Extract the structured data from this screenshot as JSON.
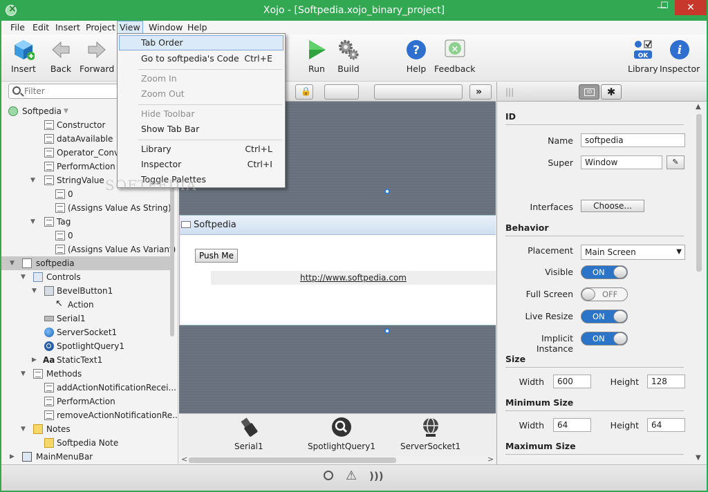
{
  "window": {
    "title": "Xojo - [Softpedia.xojo_binary_project]",
    "minimize_glyph": "—",
    "maximize_glyph": "☐",
    "close_glyph": "✕",
    "accent_color": "#33a853"
  },
  "menubar": [
    "File",
    "Edit",
    "Insert",
    "Project",
    "View",
    "Window",
    "Help"
  ],
  "toolbar": {
    "insert": "Insert",
    "back": "Back",
    "forward": "Forward",
    "run": "Run",
    "build": "Build",
    "help": "Help",
    "feedback": "Feedback",
    "library": "Library",
    "library_ok": "OK",
    "inspector": "Inspector"
  },
  "view_menu": {
    "tab_order": "Tab Order",
    "goto_code": "Go to softpedia's Code",
    "goto_code_shortcut": "Ctrl+E",
    "zoom_in": "Zoom In",
    "zoom_out": "Zoom Out",
    "hide_toolbar": "Hide Toolbar",
    "show_tab_bar": "Show Tab Bar",
    "library": "Library",
    "library_shortcut": "Ctrl+L",
    "inspector": "Inspector",
    "inspector_shortcut": "Ctrl+I",
    "toggle_palettes": "Toggle Palettes"
  },
  "navigator": {
    "filter_placeholder": "Filter",
    "project": "Softpedia",
    "items": [
      "Constructor",
      "dataAvailable",
      "Operator_Conver",
      "PerformAction",
      "StringValue",
      "0",
      "(Assigns Value As String)",
      "Tag",
      "0",
      "(Assigns Value As Variant)",
      "softpedia",
      "Controls",
      "BevelButton1",
      "Action",
      "Serial1",
      "ServerSocket1",
      "SpotlightQuery1",
      "StaticText1",
      "Methods",
      "addActionNotificationRecei...",
      "PerformAction",
      "removeActionNotificationRe...",
      "Notes",
      "Softpedia Note",
      "MainMenuBar"
    ]
  },
  "designer": {
    "window_title": "Softpedia",
    "push_button": "Push Me",
    "url_text": "http://www.softpedia.com",
    "tray": [
      "Serial1",
      "SpotlightQuery1",
      "ServerSocket1"
    ]
  },
  "inspector": {
    "sections": {
      "id": "ID",
      "behavior": "Behavior",
      "size": "Size",
      "min_size": "Minimum Size",
      "max_size": "Maximum Size"
    },
    "name_label": "Name",
    "name_value": "softpedia",
    "super_label": "Super",
    "super_value": "Window",
    "interfaces_label": "Interfaces",
    "choose_button": "Choose...",
    "placement_label": "Placement",
    "placement_value": "Main Screen",
    "visible_label": "Visible",
    "visible_state": "ON",
    "fullscreen_label": "Full Screen",
    "fullscreen_state": "OFF",
    "liveresize_label": "Live Resize",
    "liveresize_state": "ON",
    "implicit_label": "Implicit Instance",
    "implicit_state": "ON",
    "width_label": "Width",
    "height_label": "Height",
    "size_width": "600",
    "size_height": "128",
    "min_width": "64",
    "min_height": "64"
  },
  "watermark": "SOFTPEDIA"
}
